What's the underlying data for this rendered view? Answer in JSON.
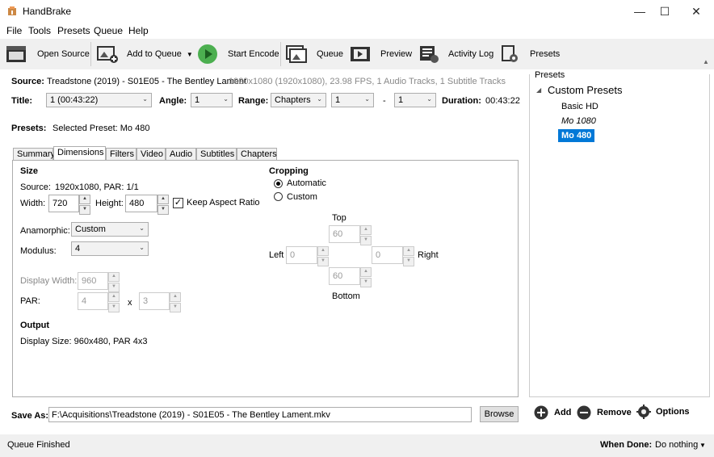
{
  "window": {
    "title": "HandBrake",
    "minimize": "—",
    "maximize": "☐",
    "close": "✕"
  },
  "menu": [
    "File",
    "Tools",
    "Presets",
    "Queue",
    "Help"
  ],
  "toolbar": {
    "open_source": "Open Source",
    "add_to_queue": "Add to Queue",
    "start_encode": "Start Encode",
    "queue": "Queue",
    "preview": "Preview",
    "activity_log": "Activity Log",
    "presets": "Presets"
  },
  "source": {
    "label": "Source:",
    "name": "Treadstone (2019) - S01E05 - The Bentley Lament",
    "info": "1920x1080 (1920x1080), 23.98 FPS, 1 Audio Tracks, 1 Subtitle Tracks"
  },
  "title_row": {
    "title_label": "Title:",
    "title_value": "1 (00:43:22)",
    "angle_label": "Angle:",
    "angle_value": "1",
    "range_label": "Range:",
    "range_type": "Chapters",
    "range_start": "1",
    "range_dash": "-",
    "range_end": "1",
    "duration_label": "Duration:",
    "duration_value": "00:43:22"
  },
  "presets_row": {
    "label": "Presets:",
    "selected": "Selected Preset:  Mo 480"
  },
  "tabs": [
    "Summary",
    "Dimensions",
    "Filters",
    "Video",
    "Audio",
    "Subtitles",
    "Chapters"
  ],
  "size": {
    "heading": "Size",
    "source_label": "Source:",
    "source_value": "1920x1080, PAR: 1/1",
    "width_label": "Width:",
    "width_value": "720",
    "height_label": "Height:",
    "height_value": "480",
    "keep_aspect": "Keep Aspect Ratio",
    "anamorphic_label": "Anamorphic:",
    "anamorphic_value": "Custom",
    "modulus_label": "Modulus:",
    "modulus_value": "4",
    "display_width_label": "Display Width:",
    "display_width_value": "960",
    "par_label": "PAR:",
    "par_x": "4",
    "par_sep": "x",
    "par_y": "3"
  },
  "output": {
    "heading": "Output",
    "display_size": "Display Size: 960x480,  PAR 4x3"
  },
  "cropping": {
    "heading": "Cropping",
    "automatic": "Automatic",
    "custom": "Custom",
    "top_label": "Top",
    "top_value": "60",
    "left_label": "Left",
    "left_value": "0",
    "right_label": "Right",
    "right_value": "0",
    "bottom_label": "Bottom",
    "bottom_value": "60"
  },
  "save_as": {
    "label": "Save As:",
    "path": "F:\\Acquisitions\\Treadstone (2019) - S01E05 - The Bentley Lament.mkv",
    "browse": "Browse"
  },
  "presets_panel": {
    "heading": "Presets",
    "group": "Custom Presets",
    "items": [
      "Basic HD",
      "Mo 1080",
      "Mo 480"
    ],
    "add": "Add",
    "remove": "Remove",
    "options": "Options"
  },
  "status": {
    "text": "Queue Finished",
    "when_done_label": "When Done:",
    "when_done_value": "Do nothing"
  },
  "colors": {
    "selection": "#0078d7",
    "start_green": "#4caf50"
  }
}
